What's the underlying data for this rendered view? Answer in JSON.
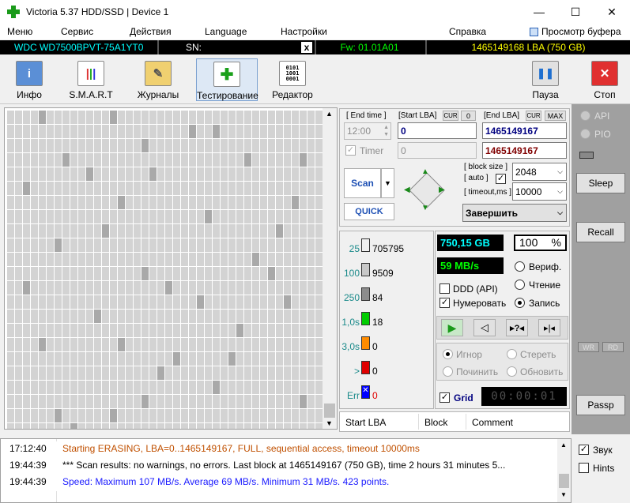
{
  "window": {
    "title": "Victoria 5.37 HDD/SSD | Device 1",
    "minimize": "—",
    "maximize": "☐",
    "close": "✕"
  },
  "menu": {
    "items": [
      "Меню",
      "Сервис",
      "Действия",
      "Language",
      "Настройки",
      "Справка"
    ],
    "buffer_view": "Просмотр буфера"
  },
  "infobar": {
    "model": "WDC WD7500BPVT-75A1YT0",
    "sn_label": "SN:",
    "sn_value": "",
    "x": "x",
    "fw": "Fw: 01.01A01",
    "lba": "1465149168 LBA (750 GB)"
  },
  "toolbar": {
    "info": "Инфо",
    "smart": "S.M.A.R.T",
    "logs": "Журналы",
    "testing": "Тестирование",
    "editor": "Редактор",
    "pause": "Пауза",
    "stop": "Стоп"
  },
  "controls": {
    "end_time_label": "[ End time ]",
    "end_time_value": "12:00",
    "start_lba_label": "[Start LBA]",
    "cur": "CUR",
    "start_cur_val": "0",
    "start_lba_value": "0",
    "end_lba_label": "[End LBA]",
    "max": "MAX",
    "end_lba_value": "1465149167",
    "end_lba_value2": "1465149167",
    "timer_label": "Timer",
    "timer_value": "0",
    "block_size_label": "[ block size ]",
    "auto_label": "[ auto ]",
    "timeout_label": "[ timeout,ms ]",
    "block_size_value": "2048",
    "timeout_value": "10000",
    "scan": "Scan",
    "quick": "QUICK",
    "finish_option": "Завершить"
  },
  "stats": [
    {
      "label": "25",
      "count": "705795",
      "color": "#f0f0f0"
    },
    {
      "label": "100",
      "count": "9509",
      "color": "#c8c8c8"
    },
    {
      "label": "250",
      "count": "84",
      "color": "#8c8c8c"
    },
    {
      "label": "1,0s",
      "count": "18",
      "color": "#00cc00"
    },
    {
      "label": "3,0s",
      "count": "0",
      "color": "#ff8c00"
    },
    {
      "label": ">",
      "count": "0",
      "color": "#e00000"
    },
    {
      "label": "Err",
      "count": "0",
      "color": "#0000ff"
    }
  ],
  "progress": {
    "size": "750,15 GB",
    "percent": "100",
    "percent_sign": "%",
    "speed": "59 MB/s",
    "percent_value": 100
  },
  "options": {
    "ddd": "DDD (API)",
    "numbering": "Нумеровать",
    "verify": "Вериф.",
    "read": "Чтение",
    "write": "Запись"
  },
  "actions": {
    "ignore": "Игнор",
    "erase": "Стереть",
    "repair": "Починить",
    "refresh": "Обновить"
  },
  "grid_label": "Grid",
  "timer_display": "00:00:01",
  "table_headers": [
    "Start LBA",
    "Block",
    "Comment"
  ],
  "log": [
    {
      "time": "17:12:40",
      "msg": "Starting ERASING, LBA=0..1465149167, FULL, sequential access, timeout 10000ms",
      "color": "#c05000"
    },
    {
      "time": "19:44:39",
      "msg": "*** Scan results: no warnings, no errors. Last block at 1465149167 (750 GB), time 2 hours 31 minutes 5...",
      "color": "#000000"
    },
    {
      "time": "19:44:39",
      "msg": "Speed: Maximum 107 MB/s. Average 69 MB/s. Minimum 31 MB/s. 423 points.",
      "color": "#1a1aff"
    }
  ],
  "side": {
    "api": "API",
    "pio": "PIO",
    "sleep": "Sleep",
    "recall": "Recall",
    "wr": "WR",
    "rd": "RD",
    "passp": "Passp",
    "sound": "Звук",
    "hints": "Hints"
  }
}
